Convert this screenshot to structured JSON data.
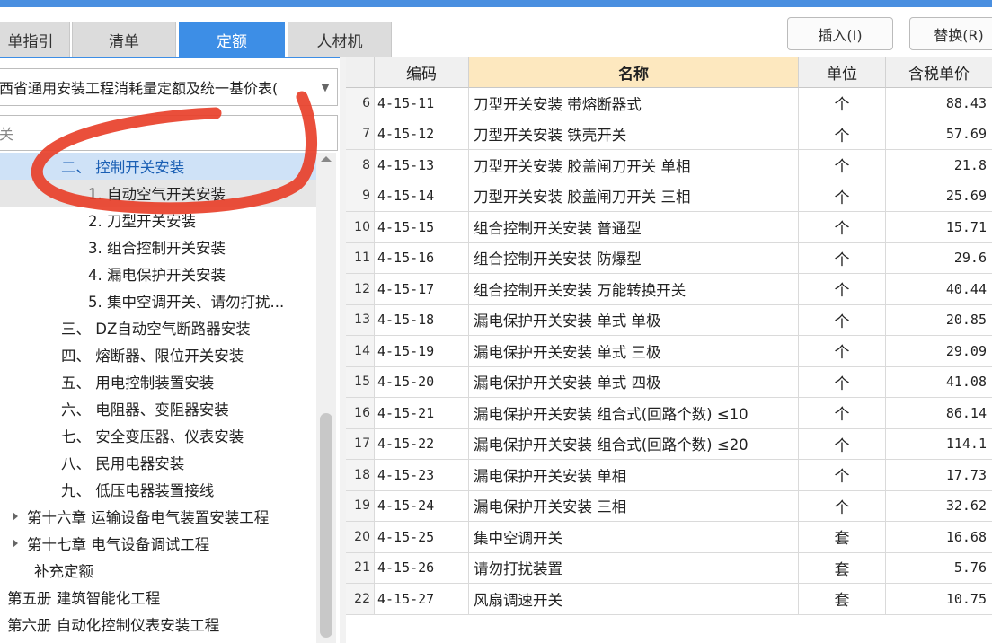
{
  "tabs": [
    {
      "label": "单指引",
      "active": false
    },
    {
      "label": "清单",
      "active": false
    },
    {
      "label": "定额",
      "active": true
    },
    {
      "label": "人材机",
      "active": false
    }
  ],
  "toolbar": {
    "insert_label": "插入(I)",
    "replace_label": "替换(R)"
  },
  "library_select": {
    "value": "西省通用安装工程消耗量定额及统一基价表("
  },
  "search": {
    "value": "关"
  },
  "tree": [
    {
      "label": "二、 控制开关安装",
      "state": "selected"
    },
    {
      "label": "1. 自动空气开关安装",
      "state": "hover"
    },
    {
      "label": "2. 刀型开关安装"
    },
    {
      "label": "3. 组合控制开关安装"
    },
    {
      "label": "4. 漏电保护开关安装"
    },
    {
      "label": "5. 集中空调开关、请勿打扰..."
    },
    {
      "label": "三、 DZ自动空气断路器安装"
    },
    {
      "label": "四、 熔断器、限位开关安装"
    },
    {
      "label": "五、 用电控制装置安装"
    },
    {
      "label": "六、 电阻器、变阻器安装"
    },
    {
      "label": "七、 安全变压器、仪表安装"
    },
    {
      "label": "八、 民用电器安装"
    },
    {
      "label": "九、 低压电器装置接线"
    },
    {
      "label": "第十六章 运输设备电气装置安装工程",
      "collapsed": true
    },
    {
      "label": "第十七章 电气设备调试工程",
      "collapsed": true
    },
    {
      "label": "补充定额"
    },
    {
      "label": "第五册 建筑智能化工程"
    },
    {
      "label": "第六册 自动化控制仪表安装工程"
    }
  ],
  "table": {
    "headers": {
      "code": "编码",
      "name": "名称",
      "unit": "单位",
      "price": "含税单价"
    },
    "rows": [
      {
        "idx": "6",
        "code": "4-15-11",
        "name": "刀型开关安装 带熔断器式",
        "unit": "个",
        "price": "88.43"
      },
      {
        "idx": "7",
        "code": "4-15-12",
        "name": "刀型开关安装 铁壳开关",
        "unit": "个",
        "price": "57.69"
      },
      {
        "idx": "8",
        "code": "4-15-13",
        "name": "刀型开关安装 胶盖闸刀开关 单相",
        "unit": "个",
        "price": "21.8"
      },
      {
        "idx": "9",
        "code": "4-15-14",
        "name": "刀型开关安装 胶盖闸刀开关 三相",
        "unit": "个",
        "price": "25.69"
      },
      {
        "idx": "10",
        "code": "4-15-15",
        "name": "组合控制开关安装 普通型",
        "unit": "个",
        "price": "15.71"
      },
      {
        "idx": "11",
        "code": "4-15-16",
        "name": "组合控制开关安装 防爆型",
        "unit": "个",
        "price": "29.6"
      },
      {
        "idx": "12",
        "code": "4-15-17",
        "name": "组合控制开关安装 万能转换开关",
        "unit": "个",
        "price": "40.44"
      },
      {
        "idx": "13",
        "code": "4-15-18",
        "name": "漏电保护开关安装 单式 单极",
        "unit": "个",
        "price": "20.85"
      },
      {
        "idx": "14",
        "code": "4-15-19",
        "name": "漏电保护开关安装 单式 三极",
        "unit": "个",
        "price": "29.09"
      },
      {
        "idx": "15",
        "code": "4-15-20",
        "name": "漏电保护开关安装 单式 四极",
        "unit": "个",
        "price": "41.08"
      },
      {
        "idx": "16",
        "code": "4-15-21",
        "name": "漏电保护开关安装 组合式(回路个数) ≤10",
        "unit": "个",
        "price": "86.14"
      },
      {
        "idx": "17",
        "code": "4-15-22",
        "name": "漏电保护开关安装 组合式(回路个数) ≤20",
        "unit": "个",
        "price": "114.1"
      },
      {
        "idx": "18",
        "code": "4-15-23",
        "name": "漏电保护开关安装 单相",
        "unit": "个",
        "price": "17.73"
      },
      {
        "idx": "19",
        "code": "4-15-24",
        "name": "漏电保护开关安装 三相",
        "unit": "个",
        "price": "32.62"
      },
      {
        "idx": "20",
        "code": "4-15-25",
        "name": "集中空调开关",
        "unit": "套",
        "price": "16.68"
      },
      {
        "idx": "21",
        "code": "4-15-26",
        "name": "请勿打扰装置",
        "unit": "套",
        "price": "5.76"
      },
      {
        "idx": "22",
        "code": "4-15-27",
        "name": "风扇调速开关",
        "unit": "套",
        "price": "10.75"
      }
    ]
  },
  "colors": {
    "accent": "#3d8ee6",
    "annotation": "#e8402a",
    "header_highlight": "#fde8bf"
  }
}
